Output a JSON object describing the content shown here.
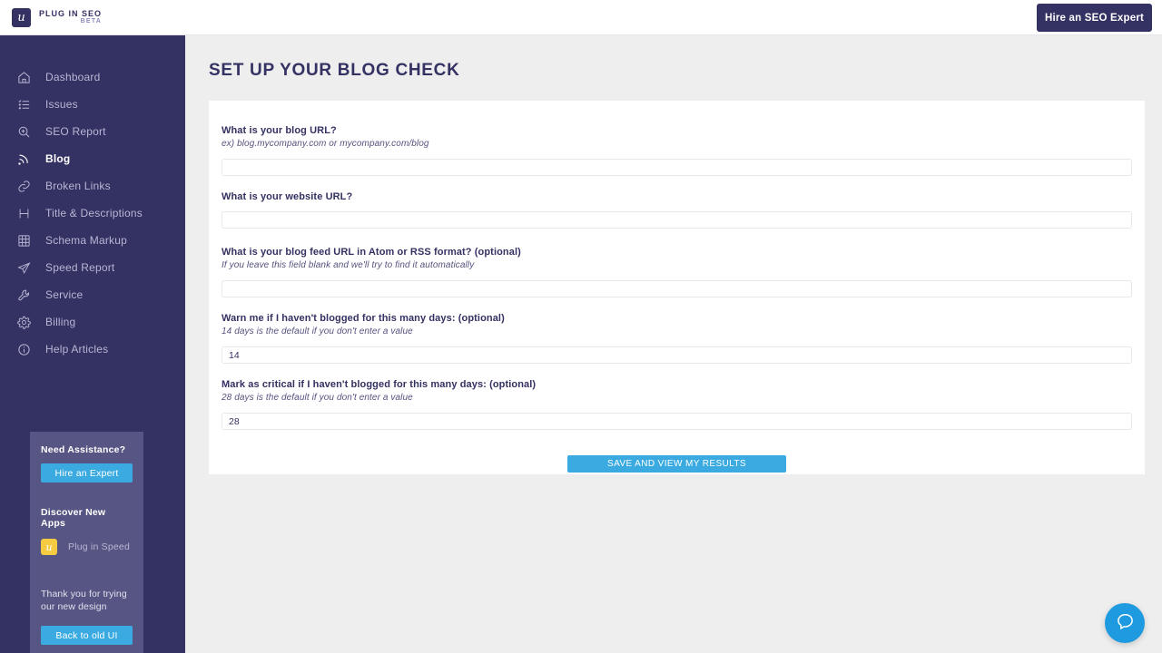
{
  "topbar": {
    "brand_name": "PLUG IN SEO",
    "brand_badge": "BETA",
    "brand_glyph": "u",
    "hire_button": "Hire an SEO Expert"
  },
  "sidebar": {
    "items": [
      {
        "label": "Dashboard",
        "icon": "home-icon",
        "active": false
      },
      {
        "label": "Issues",
        "icon": "list-icon",
        "active": false
      },
      {
        "label": "SEO Report",
        "icon": "search-plus-icon",
        "active": false
      },
      {
        "label": "Blog",
        "icon": "rss-icon",
        "active": true
      },
      {
        "label": "Broken Links",
        "icon": "link-icon",
        "active": false
      },
      {
        "label": "Title & Descriptions",
        "icon": "heading-icon",
        "active": false
      },
      {
        "label": "Schema Markup",
        "icon": "grid-icon",
        "active": false
      },
      {
        "label": "Speed Report",
        "icon": "paper-plane-icon",
        "active": false
      },
      {
        "label": "Service",
        "icon": "wrench-icon",
        "active": false
      },
      {
        "label": "Billing",
        "icon": "gear-icon",
        "active": false
      },
      {
        "label": "Help Articles",
        "icon": "info-icon",
        "active": false
      }
    ],
    "assistance": {
      "title": "Need Assistance?",
      "hire_button": "Hire an Expert",
      "discover_title": "Discover New Apps",
      "app_name": "Plug in Speed",
      "app_glyph": "u",
      "thanks_text": "Thank you for trying our new design",
      "old_ui_button": "Back to old UI"
    }
  },
  "main": {
    "page_title": "SET UP YOUR BLOG CHECK",
    "fields": [
      {
        "label": "What is your blog URL?",
        "hint": "ex) blog.mycompany.com or mycompany.com/blog",
        "value": "",
        "placeholder": ""
      },
      {
        "label": "What is your website URL?",
        "hint": "",
        "value": "",
        "placeholder": ""
      },
      {
        "label": "What is your blog feed URL in Atom or RSS format? (optional)",
        "hint": "If you leave this field blank and we'll try to find it automatically",
        "value": "",
        "placeholder": ""
      },
      {
        "label": "Warn me if I haven't blogged for this many days: (optional)",
        "hint": "14 days is the default if you don't enter a value",
        "value": "14",
        "placeholder": ""
      },
      {
        "label": "Mark as critical if I haven't blogged for this many days: (optional)",
        "hint": "28 days is the default if you don't enter a value",
        "value": "28",
        "placeholder": ""
      }
    ],
    "submit_button": "SAVE AND VIEW MY RESULTS"
  },
  "chat": {
    "icon": "chat-bubble-icon"
  },
  "colors": {
    "sidebar": "#343163",
    "card_purple": "#575583",
    "accent_blue": "#3aaae1",
    "chat_blue": "#1e9ae0",
    "app_yellow": "#f6cb42",
    "page_bg": "#eeeeee"
  }
}
